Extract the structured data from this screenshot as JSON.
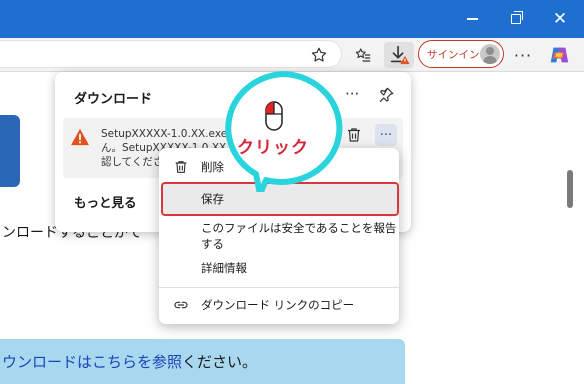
{
  "window": {
    "controls": [
      "minimize-icon",
      "restore-icon",
      "close-icon"
    ],
    "accent_color": "#1f6fd1"
  },
  "toolbar": {
    "signin_label": "サインイン",
    "icons": [
      "favorite-star-icon",
      "collections-icon",
      "download-warning-icon",
      "more-icon",
      "copilot-icon"
    ]
  },
  "downloads": {
    "title": "ダウンロード",
    "item": {
      "line1": "SetupXXXXX-1.0.XX.exe はあまりダウンロードさ",
      "line2": "ん。SetupXXXXX-1.0.XX.exe を開く前に、信頼で",
      "line3": "認してください"
    },
    "more_link": "もっと見る"
  },
  "context_menu": {
    "items": [
      {
        "label": "削除",
        "icon": "trash-icon"
      },
      {
        "label": "保存",
        "icon": ""
      },
      {
        "label": "このファイルは安全であることを報告する",
        "icon": ""
      },
      {
        "label": "詳細情報",
        "icon": ""
      },
      {
        "label": "ダウンロード リンクのコピー",
        "icon": "link-icon"
      }
    ],
    "highlight_color": "#d7383b"
  },
  "callout": {
    "label": "クリック"
  },
  "page": {
    "text_line": "ンロードすることがで",
    "bottom_link": "ウンロードはこちらを参照",
    "bottom_suffix": "ください。"
  }
}
